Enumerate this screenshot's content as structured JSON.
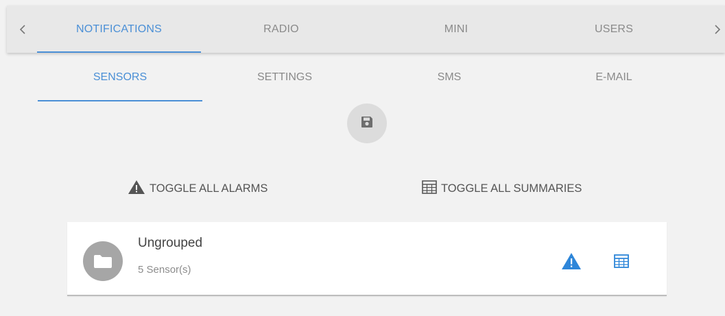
{
  "top_tabs": [
    {
      "label": "NOTIFICATIONS",
      "active": true
    },
    {
      "label": "RADIO",
      "active": false
    },
    {
      "label": "MINI",
      "active": false
    },
    {
      "label": "USERS",
      "active": false
    }
  ],
  "top_nav": {
    "prev_icon": "chevron-left-icon",
    "next_icon": "chevron-right-icon"
  },
  "sub_tabs": [
    {
      "label": "SENSORS",
      "active": true
    },
    {
      "label": "SETTINGS",
      "active": false
    },
    {
      "label": "SMS",
      "active": false
    },
    {
      "label": "E-MAIL",
      "active": false
    }
  ],
  "save": {
    "icon": "floppy-disk-icon"
  },
  "actions": {
    "toggle_alarms": {
      "label": "TOGGLE ALL ALARMS",
      "icon": "warning-icon"
    },
    "toggle_summaries": {
      "label": "TOGGLE ALL SUMMARIES",
      "icon": "table-icon"
    }
  },
  "group": {
    "name": "Ungrouped",
    "count": "5 Sensor(s)",
    "icon": "folder-icon",
    "alarm_icon": "warning-icon",
    "summary_icon": "table-icon"
  },
  "colors": {
    "accent": "#4a8fd6",
    "icon_blue": "#2e86d9",
    "text_muted": "#8a8a8a",
    "background": "#f2f2f2",
    "tab_bar": "#e8e8e8"
  }
}
